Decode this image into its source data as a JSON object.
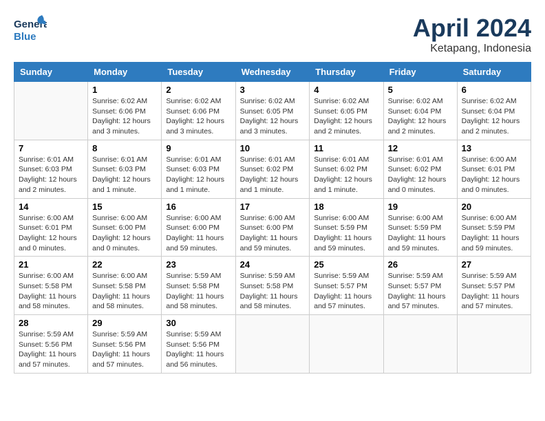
{
  "header": {
    "logo_line1": "General",
    "logo_line2": "Blue",
    "month": "April 2024",
    "location": "Ketapang, Indonesia"
  },
  "weekdays": [
    "Sunday",
    "Monday",
    "Tuesday",
    "Wednesday",
    "Thursday",
    "Friday",
    "Saturday"
  ],
  "weeks": [
    [
      {
        "day": "",
        "info": ""
      },
      {
        "day": "1",
        "info": "Sunrise: 6:02 AM\nSunset: 6:06 PM\nDaylight: 12 hours\nand 3 minutes."
      },
      {
        "day": "2",
        "info": "Sunrise: 6:02 AM\nSunset: 6:06 PM\nDaylight: 12 hours\nand 3 minutes."
      },
      {
        "day": "3",
        "info": "Sunrise: 6:02 AM\nSunset: 6:05 PM\nDaylight: 12 hours\nand 3 minutes."
      },
      {
        "day": "4",
        "info": "Sunrise: 6:02 AM\nSunset: 6:05 PM\nDaylight: 12 hours\nand 2 minutes."
      },
      {
        "day": "5",
        "info": "Sunrise: 6:02 AM\nSunset: 6:04 PM\nDaylight: 12 hours\nand 2 minutes."
      },
      {
        "day": "6",
        "info": "Sunrise: 6:02 AM\nSunset: 6:04 PM\nDaylight: 12 hours\nand 2 minutes."
      }
    ],
    [
      {
        "day": "7",
        "info": "Sunrise: 6:01 AM\nSunset: 6:03 PM\nDaylight: 12 hours\nand 2 minutes."
      },
      {
        "day": "8",
        "info": "Sunrise: 6:01 AM\nSunset: 6:03 PM\nDaylight: 12 hours\nand 1 minute."
      },
      {
        "day": "9",
        "info": "Sunrise: 6:01 AM\nSunset: 6:03 PM\nDaylight: 12 hours\nand 1 minute."
      },
      {
        "day": "10",
        "info": "Sunrise: 6:01 AM\nSunset: 6:02 PM\nDaylight: 12 hours\nand 1 minute."
      },
      {
        "day": "11",
        "info": "Sunrise: 6:01 AM\nSunset: 6:02 PM\nDaylight: 12 hours\nand 1 minute."
      },
      {
        "day": "12",
        "info": "Sunrise: 6:01 AM\nSunset: 6:02 PM\nDaylight: 12 hours\nand 0 minutes."
      },
      {
        "day": "13",
        "info": "Sunrise: 6:00 AM\nSunset: 6:01 PM\nDaylight: 12 hours\nand 0 minutes."
      }
    ],
    [
      {
        "day": "14",
        "info": "Sunrise: 6:00 AM\nSunset: 6:01 PM\nDaylight: 12 hours\nand 0 minutes."
      },
      {
        "day": "15",
        "info": "Sunrise: 6:00 AM\nSunset: 6:00 PM\nDaylight: 12 hours\nand 0 minutes."
      },
      {
        "day": "16",
        "info": "Sunrise: 6:00 AM\nSunset: 6:00 PM\nDaylight: 11 hours\nand 59 minutes."
      },
      {
        "day": "17",
        "info": "Sunrise: 6:00 AM\nSunset: 6:00 PM\nDaylight: 11 hours\nand 59 minutes."
      },
      {
        "day": "18",
        "info": "Sunrise: 6:00 AM\nSunset: 5:59 PM\nDaylight: 11 hours\nand 59 minutes."
      },
      {
        "day": "19",
        "info": "Sunrise: 6:00 AM\nSunset: 5:59 PM\nDaylight: 11 hours\nand 59 minutes."
      },
      {
        "day": "20",
        "info": "Sunrise: 6:00 AM\nSunset: 5:59 PM\nDaylight: 11 hours\nand 59 minutes."
      }
    ],
    [
      {
        "day": "21",
        "info": "Sunrise: 6:00 AM\nSunset: 5:58 PM\nDaylight: 11 hours\nand 58 minutes."
      },
      {
        "day": "22",
        "info": "Sunrise: 6:00 AM\nSunset: 5:58 PM\nDaylight: 11 hours\nand 58 minutes."
      },
      {
        "day": "23",
        "info": "Sunrise: 5:59 AM\nSunset: 5:58 PM\nDaylight: 11 hours\nand 58 minutes."
      },
      {
        "day": "24",
        "info": "Sunrise: 5:59 AM\nSunset: 5:58 PM\nDaylight: 11 hours\nand 58 minutes."
      },
      {
        "day": "25",
        "info": "Sunrise: 5:59 AM\nSunset: 5:57 PM\nDaylight: 11 hours\nand 57 minutes."
      },
      {
        "day": "26",
        "info": "Sunrise: 5:59 AM\nSunset: 5:57 PM\nDaylight: 11 hours\nand 57 minutes."
      },
      {
        "day": "27",
        "info": "Sunrise: 5:59 AM\nSunset: 5:57 PM\nDaylight: 11 hours\nand 57 minutes."
      }
    ],
    [
      {
        "day": "28",
        "info": "Sunrise: 5:59 AM\nSunset: 5:56 PM\nDaylight: 11 hours\nand 57 minutes."
      },
      {
        "day": "29",
        "info": "Sunrise: 5:59 AM\nSunset: 5:56 PM\nDaylight: 11 hours\nand 57 minutes."
      },
      {
        "day": "30",
        "info": "Sunrise: 5:59 AM\nSunset: 5:56 PM\nDaylight: 11 hours\nand 56 minutes."
      },
      {
        "day": "",
        "info": ""
      },
      {
        "day": "",
        "info": ""
      },
      {
        "day": "",
        "info": ""
      },
      {
        "day": "",
        "info": ""
      }
    ]
  ]
}
